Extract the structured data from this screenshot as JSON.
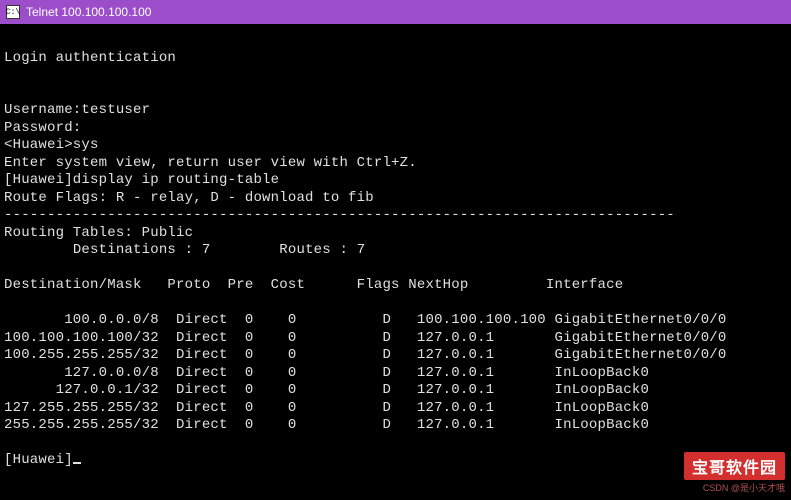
{
  "window": {
    "title": "Telnet 100.100.100.100",
    "icon_glyph": "C:\\"
  },
  "session": {
    "auth_header": "Login authentication",
    "username_label": "Username:",
    "username_value": "testuser",
    "password_label": "Password:",
    "prompt1": "<Huawei>sys",
    "sysview_msg": "Enter system view, return user view with Ctrl+Z.",
    "cmd_line": "[Huawei]display ip routing-table",
    "flags_legend": "Route Flags: R - relay, D - download to fib",
    "divider": "------------------------------------------------------------------------------",
    "tables_header": "Routing Tables: Public",
    "dest_count_label": "Destinations :",
    "dest_count": "7",
    "routes_count_label": "Routes :",
    "routes_count": "7",
    "columns": {
      "dest": "Destination/Mask",
      "proto": "Proto",
      "pre": "Pre",
      "cost": "Cost",
      "flags": "Flags",
      "nexthop": "NextHop",
      "iface": "Interface"
    },
    "routes": [
      {
        "dest": "100.0.0.0/8",
        "proto": "Direct",
        "pre": "0",
        "cost": "0",
        "flags": "D",
        "nexthop": "100.100.100.100",
        "iface": "GigabitEthernet0/0/0"
      },
      {
        "dest": "100.100.100.100/32",
        "proto": "Direct",
        "pre": "0",
        "cost": "0",
        "flags": "D",
        "nexthop": "127.0.0.1",
        "iface": "GigabitEthernet0/0/0"
      },
      {
        "dest": "100.255.255.255/32",
        "proto": "Direct",
        "pre": "0",
        "cost": "0",
        "flags": "D",
        "nexthop": "127.0.0.1",
        "iface": "GigabitEthernet0/0/0"
      },
      {
        "dest": "127.0.0.0/8",
        "proto": "Direct",
        "pre": "0",
        "cost": "0",
        "flags": "D",
        "nexthop": "127.0.0.1",
        "iface": "InLoopBack0"
      },
      {
        "dest": "127.0.0.1/32",
        "proto": "Direct",
        "pre": "0",
        "cost": "0",
        "flags": "D",
        "nexthop": "127.0.0.1",
        "iface": "InLoopBack0"
      },
      {
        "dest": "127.255.255.255/32",
        "proto": "Direct",
        "pre": "0",
        "cost": "0",
        "flags": "D",
        "nexthop": "127.0.0.1",
        "iface": "InLoopBack0"
      },
      {
        "dest": "255.255.255.255/32",
        "proto": "Direct",
        "pre": "0",
        "cost": "0",
        "flags": "D",
        "nexthop": "127.0.0.1",
        "iface": "InLoopBack0"
      }
    ],
    "final_prompt": "[Huawei]"
  },
  "watermark": {
    "badge": "宝哥软件园",
    "sub": "CSDN @是小天才哦"
  }
}
